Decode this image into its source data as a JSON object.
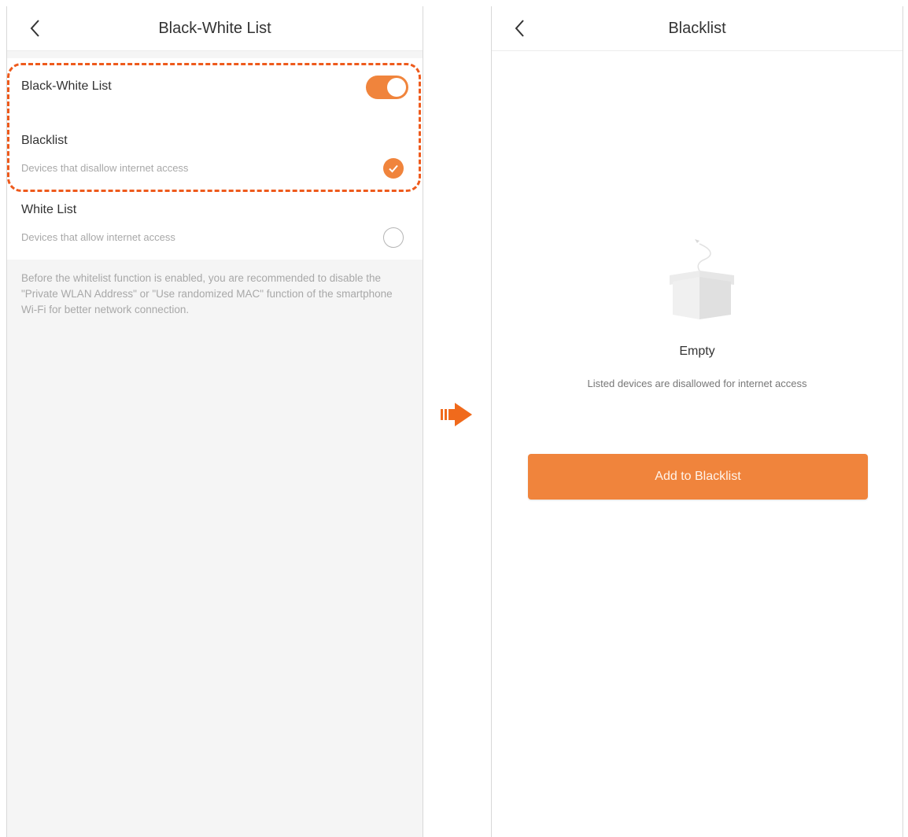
{
  "left_screen": {
    "title": "Black-White List",
    "master_toggle": {
      "label": "Black-White List",
      "state": "on"
    },
    "options": [
      {
        "label": "Blacklist",
        "description": "Devices that disallow internet access",
        "selected": true
      },
      {
        "label": "White List",
        "description": "Devices that allow internet access",
        "selected": false
      }
    ],
    "note": "Before the whitelist function is enabled, you are recommended to disable the \"Private WLAN Address\" or \"Use randomized MAC\" function of the smartphone Wi-Fi for better network connection."
  },
  "right_screen": {
    "title": "Blacklist",
    "empty_title": "Empty",
    "empty_description": "Listed devices are disallowed for internet access",
    "add_button_label": "Add to Blacklist"
  },
  "colors": {
    "accent": "#f0843c",
    "highlight_dash": "#ee5a1c",
    "arrow": "#f06a1c",
    "background": "#f5f5f5"
  },
  "icons": {
    "back": "chevron-left-icon",
    "check": "checkmark-icon",
    "transition": "arrow-right-icon",
    "empty": "empty-box-icon"
  }
}
